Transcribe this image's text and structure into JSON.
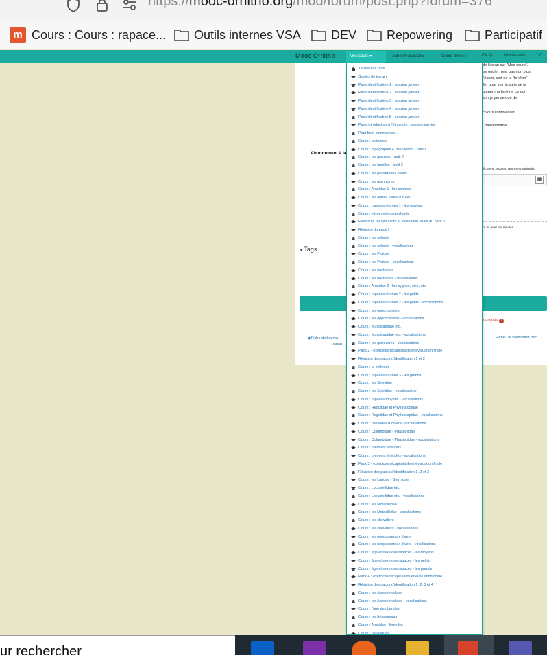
{
  "browser": {
    "url_prefix": "https://",
    "url_host": "mooc-ornitho.org",
    "url_path": "/mod/forum/post.php?forum=376",
    "bookmarks": [
      {
        "label": "Cours : Cours : rapace...",
        "icon": "moodle-logo-icon"
      },
      {
        "label": "Outils internes VSA",
        "icon": "folder-icon"
      },
      {
        "label": "DEV",
        "icon": "folder-icon"
      },
      {
        "label": "Repowering",
        "icon": "folder-icon"
      },
      {
        "label": "Participatif",
        "icon": "folder-icon"
      }
    ]
  },
  "navbar": {
    "brand": "Mooc Ornitho",
    "items": [
      "Mes cours ▾",
      "Acheter un pack ▸",
      "Cours démo ▸",
      "F.A.Q.",
      "Urd les avis",
      "C"
    ]
  },
  "page": {
    "text_fragments": [
      "de l'écran sur \"Mes cours\".",
      "tre onglet n'est pas non plus",
      "l'écran, sort de la \"fenêtre\"",
      "ller pour voir la suite de la",
      "oomer ma fenêtre, ce qui",
      "son je pense que de",
      "c vous compreniez.",
      ", passionnante !",
      "fichiers : 500Ko, Nombre maximal d",
      "re ici pour les ajouter"
    ],
    "subscription_label": "Abonnement à la",
    "tags_label": "Tags",
    "required_label": "marqués",
    "required_icon": "!",
    "prev_link_line1": "◀ Fiche d'observa",
    "prev_link_line2": "variab",
    "next_link": "Fiche : le Balbuzard pêc"
  },
  "dropdown": {
    "items": [
      {
        "label": "Tableau de bord",
        "icon": "home-icon"
      },
      {
        "label": "Sorties de terrain",
        "icon": "cap-icon"
      },
      {
        "label": "Pack identification 1 - session janvier",
        "icon": "cap-icon"
      },
      {
        "label": "Pack identification 2 - session janvier",
        "icon": "cap-icon"
      },
      {
        "label": "Pack identification 3 - session janvier",
        "icon": "cap-icon"
      },
      {
        "label": "Pack identification 4 - session janvier",
        "icon": "cap-icon"
      },
      {
        "label": "Pack identification 5 - session janvier",
        "icon": "cap-icon"
      },
      {
        "label": "Pack introduction à l'éthologie - session janvier",
        "icon": "cap-icon"
      },
      {
        "label": "Pour bien commencer...",
        "icon": "cap-icon"
      },
      {
        "label": "Cours : taxinomie",
        "icon": "cap-icon"
      },
      {
        "label": "Cours : topographie & description - outil 1",
        "icon": "cap-icon"
      },
      {
        "label": "Cours : les groupes - outil 2",
        "icon": "cap-icon"
      },
      {
        "label": "Cours : les familles - outil 3",
        "icon": "cap-icon"
      },
      {
        "label": "Cours : les passereaux divers",
        "icon": "cap-icon"
      },
      {
        "label": "Cours : les granivores",
        "icon": "cap-icon"
      },
      {
        "label": "Cours : Anatidae 1 - les canards",
        "icon": "cap-icon"
      },
      {
        "label": "Cours : les autres oiseaux d'eau",
        "icon": "cap-icon"
      },
      {
        "label": "Cours : rapaces diurnes 1 - les moyens",
        "icon": "cap-icon"
      },
      {
        "label": "Cours : introduction aux chants",
        "icon": "cap-icon"
      },
      {
        "label": "Exercices récapitulatifs et évaluation finale du pack 1",
        "icon": "cap-icon"
      },
      {
        "label": "Révision du pack 1",
        "icon": "cap-icon"
      },
      {
        "label": "Cours : les colorés",
        "icon": "cap-icon"
      },
      {
        "label": "Cours : les colorés - vocalisations",
        "icon": "cap-icon"
      },
      {
        "label": "Cours : les Picidae",
        "icon": "cap-icon"
      },
      {
        "label": "Cours : les Picidae - vocalisations",
        "icon": "cap-icon"
      },
      {
        "label": "Cours : les nocturnes",
        "icon": "cap-icon"
      },
      {
        "label": "Cours : les nocturnes - vocalisations",
        "icon": "cap-icon"
      },
      {
        "label": "Cours : Anatidae 2 - les cygnes, oies, etc.",
        "icon": "cap-icon"
      },
      {
        "label": "Cours : rapaces diurnes 2 - les petits",
        "icon": "cap-icon"
      },
      {
        "label": "Cours : rapaces diurnes 2 - les petits - vocalisations",
        "icon": "cap-icon"
      },
      {
        "label": "Cours : les opportunistes",
        "icon": "cap-icon"
      },
      {
        "label": "Cours : les opportunistes - vocalisations",
        "icon": "cap-icon"
      },
      {
        "label": "Cours : Muscicapidae etc.",
        "icon": "cap-icon"
      },
      {
        "label": "Cours : Muscicapidae etc. - vocalisations",
        "icon": "cap-icon"
      },
      {
        "label": "Cours : les granivores - vocalisations",
        "icon": "cap-icon"
      },
      {
        "label": "Pack 2 - exercices récapitulatifs et évaluation finale",
        "icon": "cap-icon"
      },
      {
        "label": "Révision des packs d'identification 1 et 2",
        "icon": "cap-icon"
      },
      {
        "label": "Cours : la méthode",
        "icon": "cap-icon"
      },
      {
        "label": "Cours : rapaces diurnes 3 - les grands",
        "icon": "cap-icon"
      },
      {
        "label": "Cours : les Sylviidae",
        "icon": "cap-icon"
      },
      {
        "label": "Cours : les Sylviidae - vocalisations",
        "icon": "cap-icon"
      },
      {
        "label": "Cours : rapaces moyens - vocalisations",
        "icon": "cap-icon"
      },
      {
        "label": "Cours : Regulidae et Phylloscopidae",
        "icon": "cap-icon"
      },
      {
        "label": "Cours : Regulidae et Phylloscopidae - vocalisations",
        "icon": "cap-icon"
      },
      {
        "label": "Cours : passereaux divers - vocalisations",
        "icon": "cap-icon"
      },
      {
        "label": "Cours : Columbidae - Phasianidae",
        "icon": "cap-icon"
      },
      {
        "label": "Cours : Columbidae - Phasianidae - vocalisations",
        "icon": "cap-icon"
      },
      {
        "label": "Cours : premiers limicoles",
        "icon": "cap-icon"
      },
      {
        "label": "Cours : premiers limicoles - vocalisations",
        "icon": "cap-icon"
      },
      {
        "label": "Pack 3 - exercices récapitulatifs et évaluation finale",
        "icon": "cap-icon"
      },
      {
        "label": "Révision des packs d'identification 1, 2 et 3",
        "icon": "cap-icon"
      },
      {
        "label": "Cours : les Laridae - Sternidae",
        "icon": "cap-icon"
      },
      {
        "label": "Cours : Locustellidae etc.",
        "icon": "cap-icon"
      },
      {
        "label": "Cours : Locustellidae etc. - vocalisations",
        "icon": "cap-icon"
      },
      {
        "label": "Cours : les Motacillidae",
        "icon": "cap-icon"
      },
      {
        "label": "Cours : les Motacillidae - vocalisations",
        "icon": "cap-icon"
      },
      {
        "label": "Cours : les chevaliers",
        "icon": "cap-icon"
      },
      {
        "label": "Cours : les chevaliers - vocalisations",
        "icon": "cap-icon"
      },
      {
        "label": "Cours : les nonpasseraux divers",
        "icon": "cap-icon"
      },
      {
        "label": "Cours : les nonpasseraux divers - vocalisations",
        "icon": "cap-icon"
      },
      {
        "label": "Cours : âge et sexe des rapaces - les moyens",
        "icon": "cap-icon"
      },
      {
        "label": "Cours : âge et sexe des rapaces - les petits",
        "icon": "cap-icon"
      },
      {
        "label": "Cours : âge et sexe des rapaces - les grands",
        "icon": "cap-icon"
      },
      {
        "label": "Pack 4 : exercices récapitulatifs et évaluation finale",
        "icon": "cap-icon"
      },
      {
        "label": "Révision des packs d'identification 1, 2, 3 et 4",
        "icon": "cap-icon"
      },
      {
        "label": "Cours : les Acrocephalidae",
        "icon": "cap-icon"
      },
      {
        "label": "Cours : les Acrocephalidae - vocalisations",
        "icon": "cap-icon"
      },
      {
        "label": "Cours : l'âge des Laridae",
        "icon": "cap-icon"
      },
      {
        "label": "Cours : les bécasseaux",
        "icon": "cap-icon"
      },
      {
        "label": "Cours : Anatidae - femelles",
        "icon": "cap-icon"
      },
      {
        "label": "Cours : pélagiques",
        "icon": "cap-icon"
      }
    ]
  },
  "taskbar": {
    "search_text": "ur rechercher",
    "apps": [
      "outlook-icon",
      "onenote-icon",
      "firefox-icon",
      "file-explorer-icon",
      "active-app-icon",
      "teams-icon"
    ]
  },
  "colors": {
    "navbar": "#1aaa9e",
    "page_background": "#e9e7ca",
    "link": "#1a6fb0",
    "required": "#c0392b"
  }
}
